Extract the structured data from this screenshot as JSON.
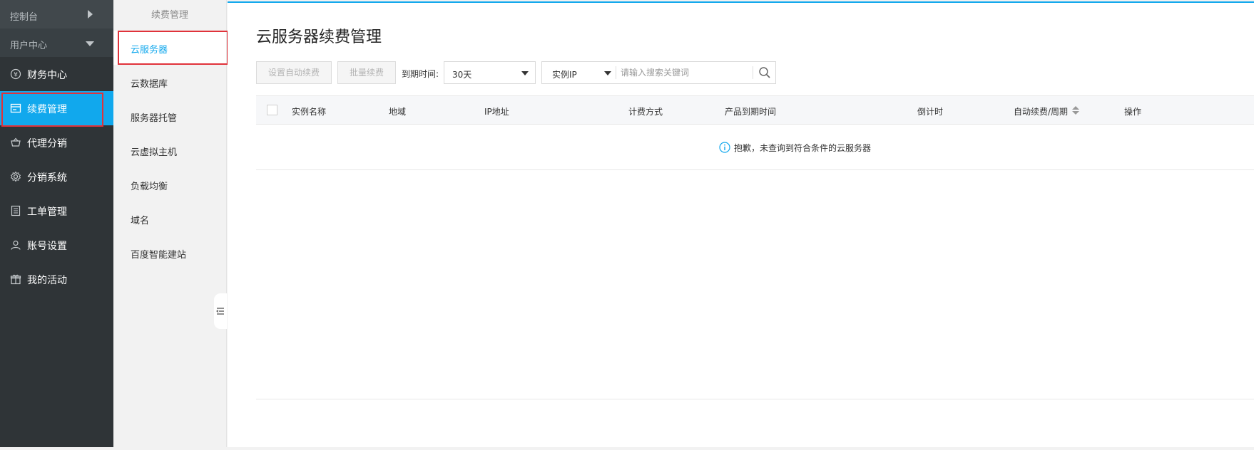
{
  "sidebar": {
    "console_label": "控制台",
    "user_center_label": "用户中心",
    "items": [
      {
        "label": "财务中心",
        "icon": "yen-circle-icon"
      },
      {
        "label": "续费管理",
        "icon": "renewal-icon"
      },
      {
        "label": "代理分销",
        "icon": "basket-icon"
      },
      {
        "label": "分销系统",
        "icon": "gear-icon"
      },
      {
        "label": "工单管理",
        "icon": "document-icon"
      },
      {
        "label": "账号设置",
        "icon": "user-icon"
      },
      {
        "label": "我的活动",
        "icon": "gift-icon"
      }
    ],
    "active_index": 1
  },
  "subnav": {
    "title": "续费管理",
    "items": [
      {
        "label": "云服务器"
      },
      {
        "label": "云数据库"
      },
      {
        "label": "服务器托管"
      },
      {
        "label": "云虚拟主机"
      },
      {
        "label": "负载均衡"
      },
      {
        "label": "域名"
      },
      {
        "label": "百度智能建站"
      }
    ],
    "active_index": 0
  },
  "main": {
    "title": "云服务器续费管理",
    "toolbar": {
      "auto_renew_label": "设置自动续费",
      "batch_renew_label": "批量续费",
      "expire_label": "到期时间:",
      "expire_value": "30天",
      "search_type": "实例IP",
      "search_placeholder": "请输入搜索关键词"
    },
    "table": {
      "columns": [
        "实例名称",
        "地域",
        "IP地址",
        "计费方式",
        "产品到期时间",
        "倒计时",
        "自动续费/周期",
        "操作"
      ],
      "empty_message": "抱歉，未查询到符合条件的云服务器"
    }
  },
  "colors": {
    "accent": "#11a8ed",
    "sidebar_bg": "#2f3437",
    "highlight": "#e0323a"
  }
}
